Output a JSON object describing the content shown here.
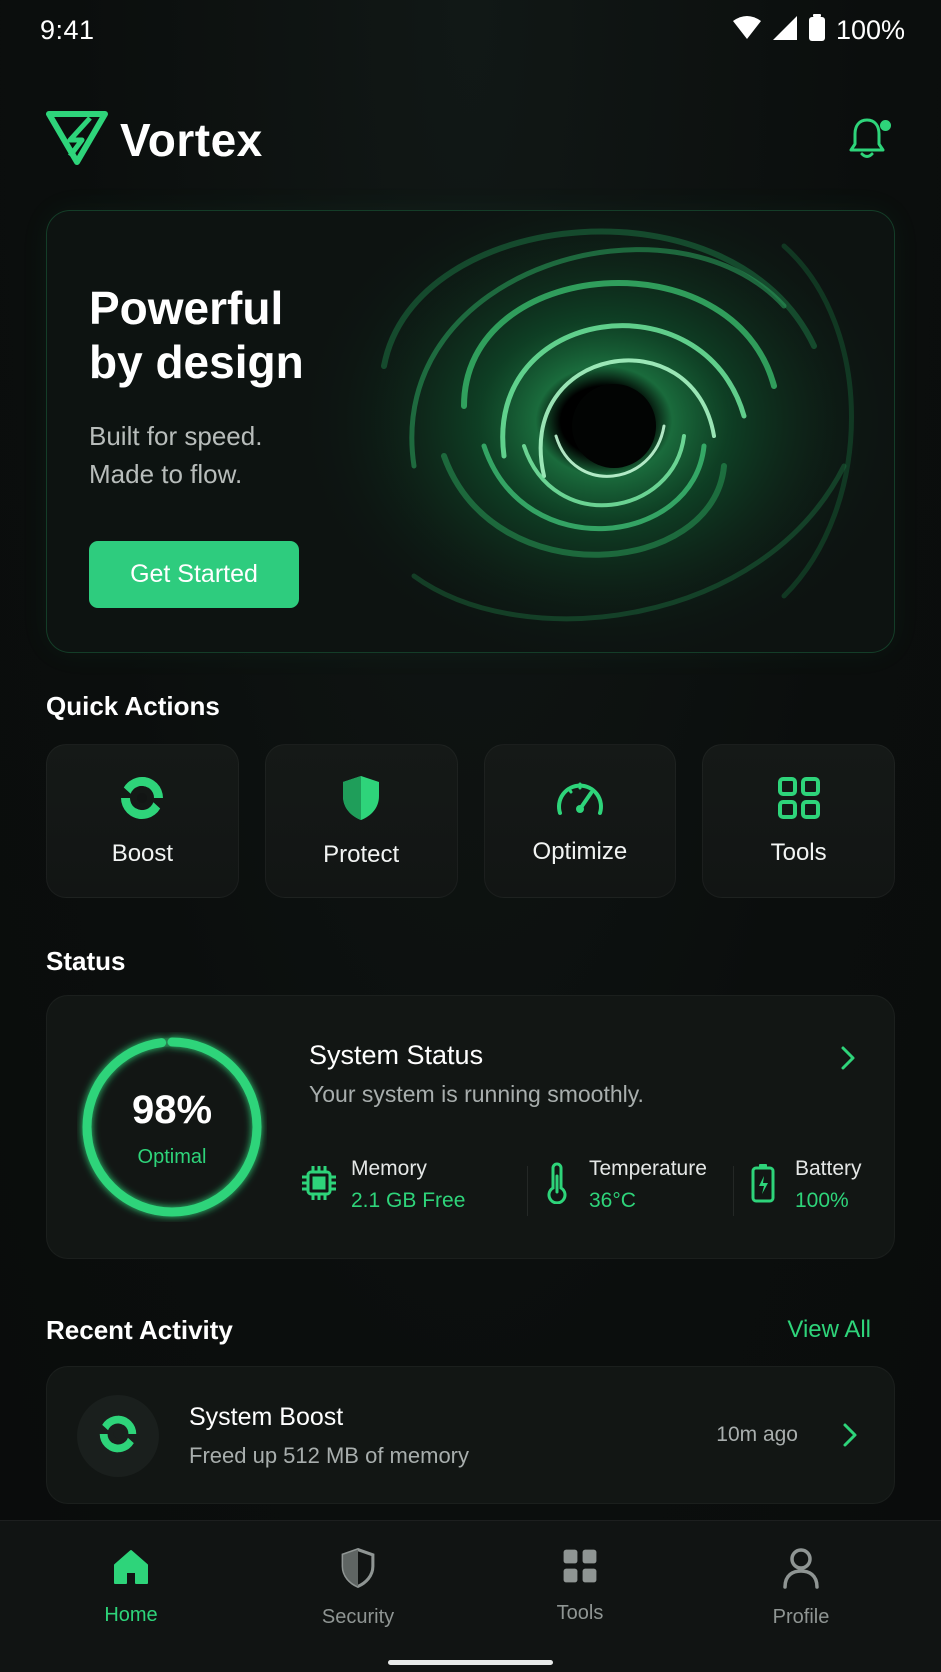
{
  "status_bar": {
    "time": "9:41",
    "battery": "100%"
  },
  "header": {
    "brand": "Vortex"
  },
  "hero": {
    "title_line1": "Powerful",
    "title_line2": "by design",
    "subtitle_line1": "Built for speed.",
    "subtitle_line2": "Made to flow.",
    "cta": "Get Started"
  },
  "quick_actions": {
    "title": "Quick Actions",
    "items": [
      {
        "label": "Boost",
        "icon": "swirl-icon"
      },
      {
        "label": "Protect",
        "icon": "shield-icon"
      },
      {
        "label": "Optimize",
        "icon": "speedometer-icon"
      },
      {
        "label": "Tools",
        "icon": "grid-icon"
      }
    ]
  },
  "status": {
    "section_title": "Status",
    "percent": "98%",
    "percent_value": 98,
    "rating": "Optimal",
    "title": "System Status",
    "subtitle": "Your system is running smoothly.",
    "metrics": [
      {
        "name": "Memory",
        "value": "2.1 GB Free",
        "icon": "chip-icon"
      },
      {
        "name": "Temperature",
        "value": "36°C",
        "icon": "thermometer-icon"
      },
      {
        "name": "Battery",
        "value": "100%",
        "icon": "battery-icon"
      }
    ]
  },
  "recent_activity": {
    "title": "Recent Activity",
    "view_all": "View All",
    "items": [
      {
        "title": "System Boost",
        "subtitle": "Freed up 512 MB of memory",
        "time": "10m ago",
        "icon": "swirl-icon"
      }
    ]
  },
  "bottom_nav": {
    "items": [
      {
        "label": "Home",
        "icon": "home-icon",
        "active": true
      },
      {
        "label": "Security",
        "icon": "shield-icon",
        "active": false
      },
      {
        "label": "Tools",
        "icon": "grid-icon",
        "active": false
      },
      {
        "label": "Profile",
        "icon": "person-icon",
        "active": false
      }
    ]
  },
  "colors": {
    "accent": "#2ed47a",
    "background": "#0b0e0d",
    "card": "#121614"
  }
}
